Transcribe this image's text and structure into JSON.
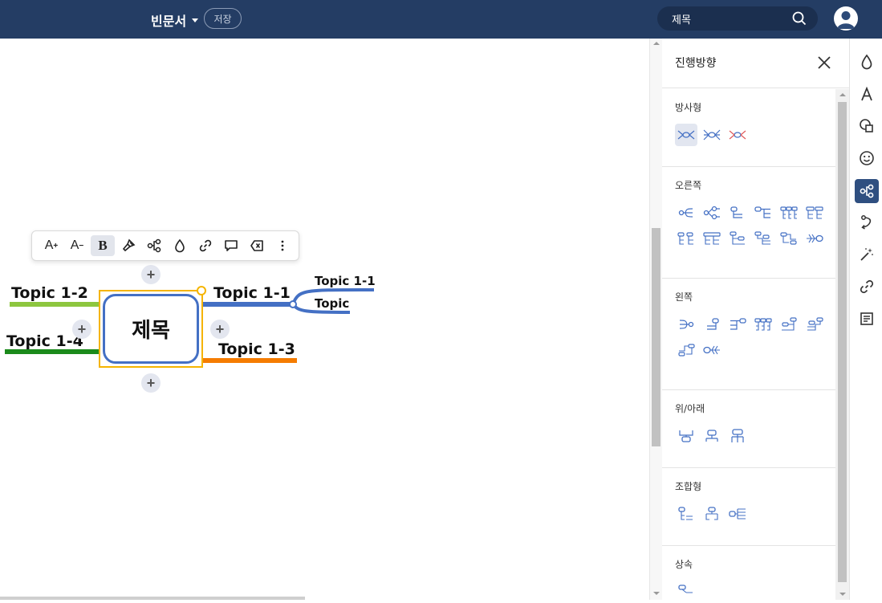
{
  "app": {
    "doc_title": "빈문서",
    "save_label": "저장",
    "search_value": "제목"
  },
  "toolbar": {
    "font_up": "A",
    "font_up_sup": "+",
    "font_down": "A",
    "font_down_sup": "−",
    "bold": "B"
  },
  "mindmap": {
    "central": "제목",
    "topics": {
      "t11": "Topic 1-1",
      "t12": "Topic 1-2",
      "t13": "Topic 1-3",
      "t14": "Topic 1-4",
      "sub1": "Topic 1-1",
      "sub2": "Topic"
    },
    "colors": {
      "t11": "#4470c4",
      "t12": "#8dc63f",
      "t13": "#f57c00",
      "t14": "#1b8a1b"
    }
  },
  "panel": {
    "title": "진행방향",
    "sections": [
      {
        "label": "방사형"
      },
      {
        "label": "오른쪽"
      },
      {
        "label": "왼쪽"
      },
      {
        "label": "위/아래"
      },
      {
        "label": "조합형"
      },
      {
        "label": "상속"
      }
    ]
  },
  "rail": {
    "icons": [
      "drop-icon",
      "text-icon",
      "shape-icon",
      "emoji-icon",
      "layout-icon",
      "relation-icon",
      "magic-icon",
      "link-icon",
      "note-icon"
    ],
    "active": "layout-icon",
    "accent": "#2f4f80"
  }
}
